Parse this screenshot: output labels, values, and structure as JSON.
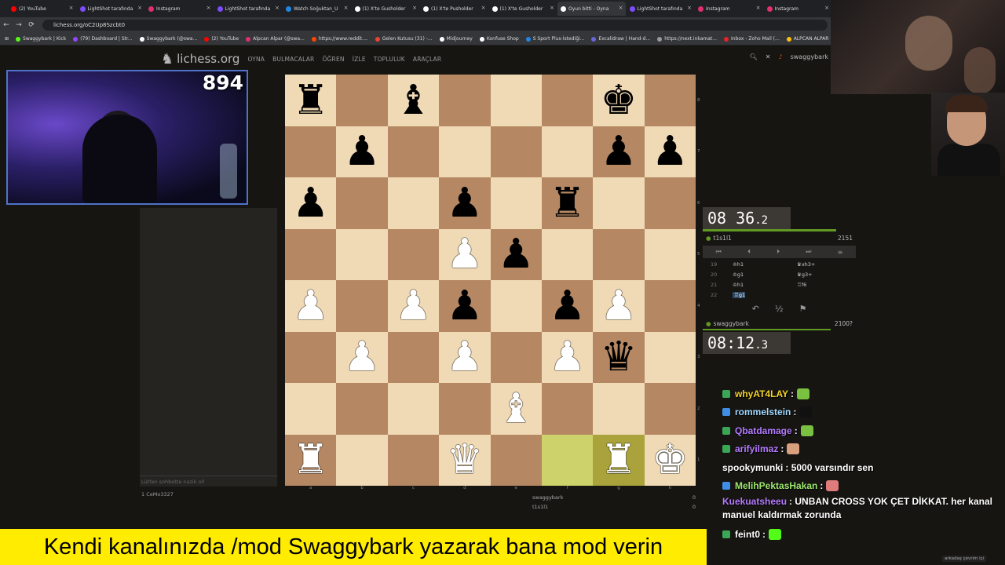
{
  "browser": {
    "tabs": [
      {
        "label": "(2) YouTube",
        "color": "#ff0000",
        "active": false
      },
      {
        "label": "LightShot tarafında",
        "color": "#7c4dff",
        "active": false
      },
      {
        "label": "Instagram",
        "color": "#e1306c",
        "active": false
      },
      {
        "label": "LightShot tarafında",
        "color": "#7c4dff",
        "active": false
      },
      {
        "label": "Watch Soğuktan_U",
        "color": "#1e88e5",
        "active": false
      },
      {
        "label": "(1) X'te Gusholder",
        "color": "#ffffff",
        "active": false
      },
      {
        "label": "(1) X'te Pusholder",
        "color": "#ffffff",
        "active": false
      },
      {
        "label": "(1) X'te Gusholder",
        "color": "#ffffff",
        "active": false
      },
      {
        "label": "Oyun bitti - Oyna",
        "color": "#ffffff",
        "active": true
      },
      {
        "label": "LightShot tarafında",
        "color": "#7c4dff",
        "active": false
      },
      {
        "label": "Instagram",
        "color": "#e1306c",
        "active": false
      },
      {
        "label": "Instagram",
        "color": "#e1306c",
        "active": false
      }
    ],
    "url": "lichess.org/oC2Up8Szcbt0",
    "bookmarks": [
      {
        "label": "Swaggybark | Kick",
        "color": "#53fc18"
      },
      {
        "label": "(79) Dashboard | Str...",
        "color": "#9146ff"
      },
      {
        "label": "Swaggybark (@swa...",
        "color": "#ffffff"
      },
      {
        "label": "(2) YouTube",
        "color": "#ff0000"
      },
      {
        "label": "Alpcan Alpar (@swa...",
        "color": "#e1306c"
      },
      {
        "label": "https://www.reddit....",
        "color": "#ff4500"
      },
      {
        "label": "Gelen Kutusu (31) -...",
        "color": "#ea4335"
      },
      {
        "label": "Midjourney",
        "color": "#ffffff"
      },
      {
        "label": "Konfuse Shop",
        "color": "#ffffff"
      },
      {
        "label": "S Sport Plus-İstediği...",
        "color": "#1e88e5"
      },
      {
        "label": "Excalidraw | Hand-d...",
        "color": "#6965db"
      },
      {
        "label": "https://next.inkamat...",
        "color": "#999999"
      },
      {
        "label": "Inbox - Zoho Mail (...",
        "color": "#e42527"
      },
      {
        "label": "ALPCAN ALPAR DEV...",
        "color": "#ffc107"
      },
      {
        "label": "Ma",
        "color": "#4285f4"
      }
    ]
  },
  "lichess": {
    "logo": "lichess.org",
    "nav": [
      "OYNA",
      "BULMACALAR",
      "ÖĞREN",
      "İZLE",
      "TOPLULUK",
      "ARAÇLAR"
    ],
    "username": "swaggybark",
    "chat_placeholder": "Lütfen sohbette nazik ol!",
    "spectators": "1  CeMo3327",
    "board": [
      [
        "bR",
        "",
        "bB",
        "",
        "",
        "",
        "bK",
        ""
      ],
      [
        "",
        "bP",
        "",
        "",
        "",
        "",
        "bP",
        "bP"
      ],
      [
        "bP",
        "",
        "",
        "bP",
        "",
        "bR",
        "",
        ""
      ],
      [
        "",
        "",
        "",
        "wP",
        "bP",
        "",
        "",
        ""
      ],
      [
        "wP",
        "",
        "wP",
        "bP",
        "",
        "bP",
        "wP",
        ""
      ],
      [
        "",
        "wP",
        "",
        "wP",
        "",
        "wP",
        "bQ",
        ""
      ],
      [
        "",
        "",
        "",
        "",
        "wB",
        "",
        "",
        ""
      ],
      [
        "wR",
        "",
        "",
        "wQ",
        "",
        "",
        "wR",
        "wK"
      ]
    ],
    "highlights": [
      "f1",
      "g1"
    ],
    "files": [
      "a",
      "b",
      "c",
      "d",
      "e",
      "f",
      "g",
      "h"
    ],
    "ranks": [
      "8",
      "7",
      "6",
      "5",
      "4",
      "3",
      "2",
      "1"
    ],
    "opponent": {
      "name": "t1s1l1",
      "rating": "2151",
      "clock_main": "08 36",
      "clock_tenth": ".2"
    },
    "player": {
      "name": "swaggybark",
      "rating": "2100?",
      "clock_main": "08:12",
      "clock_tenth": ".3"
    },
    "moves": [
      {
        "n": "19",
        "w": "♔h1",
        "b": "♛xh3+"
      },
      {
        "n": "20",
        "w": "♔g1",
        "b": "♛g3+"
      },
      {
        "n": "21",
        "w": "♔h1",
        "b": "♖f6"
      },
      {
        "n": "22",
        "w": "♖g1",
        "b": ""
      }
    ],
    "underboard": [
      {
        "name": "swaggybark",
        "score": "0"
      },
      {
        "name": "t1s1l1",
        "score": "0"
      }
    ]
  },
  "stream": {
    "viewer_count": "894",
    "chat": [
      {
        "user": "whyAT4LAY",
        "text": ":",
        "color": "#f5d327",
        "badge": "#3aa757",
        "emote": "#7ac142"
      },
      {
        "user": "rommelstein",
        "text": ":",
        "color": "#9fd8ff",
        "badge": "#3f8ee6",
        "emote": "#111111"
      },
      {
        "user": "Qbatdamage",
        "text": ":",
        "color": "#b57bff",
        "badge": "#3aa757",
        "emote": "#7ac142"
      },
      {
        "user": "arifyilmaz",
        "text": ":",
        "color": "#b57bff",
        "badge": "#3aa757",
        "emote": "#d8a07c"
      },
      {
        "user": "spookymunki",
        "text": ": 5000 varsındır sen",
        "color": "#ffffff",
        "badge": "",
        "emote": ""
      },
      {
        "user": "MelihPektasHakan",
        "text": ":",
        "color": "#9fe870",
        "badge": "#3f8ee6",
        "emote": "#e07b7b"
      },
      {
        "user": "Kuekuatsheeu",
        "text": ": UNBAN CROSS YOK ÇET DİKKAT. her kanal manuel kaldırmak zorunda",
        "color": "#b57bff",
        "badge": "",
        "emote": ""
      },
      {
        "user": "feint0",
        "text": ":",
        "color": "#ffffff",
        "badge": "#3aa757",
        "emote": "#53fc18"
      }
    ],
    "banner": "Kendi kanalınızda /mod Swaggybark yazarak bana mod verin",
    "translate_hint": "arkadaş çevrim içi"
  }
}
